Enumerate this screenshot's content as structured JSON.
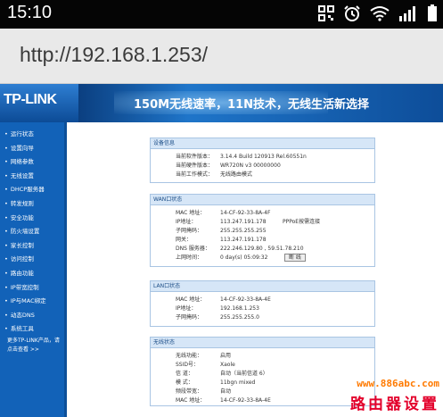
{
  "status_bar": {
    "time": "15:10",
    "icons": [
      "qr-icon",
      "alarm-icon",
      "wifi-icon",
      "signal-icon",
      "battery-icon"
    ]
  },
  "url_bar": {
    "url": "http://192.168.1.253/"
  },
  "header": {
    "logo": "TP-LINK",
    "slogan": "150M无线速率，11N技术，无线生活新选择",
    "colors": {
      "banner": "#0f4f9a",
      "slogan_accent": "#ffd400"
    }
  },
  "nav": {
    "items": [
      "运行状态",
      "设置向导",
      "网络参数",
      "无线设置",
      "DHCP服务器",
      "转发规则",
      "安全功能",
      "防火墙设置",
      "家长控制",
      "访问控制",
      "路由功能",
      "IP带宽控制",
      "IP与MAC绑定",
      "动态DNS",
      "系统工具"
    ],
    "more": "更多TP-LINK产品，请点击查看 >>"
  },
  "device_info": {
    "title": "设备信息",
    "rows": [
      {
        "label": "当前软件版本：",
        "value": "3.14.4 Build 120913 Rel.60551n"
      },
      {
        "label": "当前硬件版本：",
        "value": "WR720N v3 00000000"
      },
      {
        "label": "当前工作模式：",
        "value": "无线路由模式"
      }
    ]
  },
  "wan": {
    "title": "WAN口状态",
    "rows": [
      {
        "label": "MAC 地址：",
        "value": "14-CF-92-33-8A-4F"
      },
      {
        "label": "IP地址：",
        "value": "113.247.191.178",
        "extra": "PPPoE按需连接"
      },
      {
        "label": "子网掩码：",
        "value": "255.255.255.255"
      },
      {
        "label": "网关：",
        "value": "113.247.191.178"
      },
      {
        "label": "DNS 服务器：",
        "value": "222.246.129.80 , 59.51.78.210"
      },
      {
        "label": "上网时间：",
        "value": "0 day(s) 05:09:32"
      }
    ],
    "disconnect_label": "断 线"
  },
  "lan": {
    "title": "LAN口状态",
    "rows": [
      {
        "label": "MAC 地址：",
        "value": "14-CF-92-33-8A-4E"
      },
      {
        "label": "IP地址：",
        "value": "192.168.1.253"
      },
      {
        "label": "子网掩码：",
        "value": "255.255.255.0"
      }
    ]
  },
  "wireless": {
    "title": "无线状态",
    "rows": [
      {
        "label": "无线功能：",
        "value": "启用"
      },
      {
        "label": "SSID号：",
        "value": "Xaole"
      },
      {
        "label": "信 道：",
        "value": "自动（当前信道 6）"
      },
      {
        "label": "模 式：",
        "value": "11bgn mixed"
      },
      {
        "label": "频段带宽：",
        "value": "自动"
      },
      {
        "label": "MAC 地址：",
        "value": "14-CF-92-33-8A-4E"
      }
    ]
  },
  "watermark": {
    "url": "www.886abc.com",
    "name": "路由器设置"
  }
}
